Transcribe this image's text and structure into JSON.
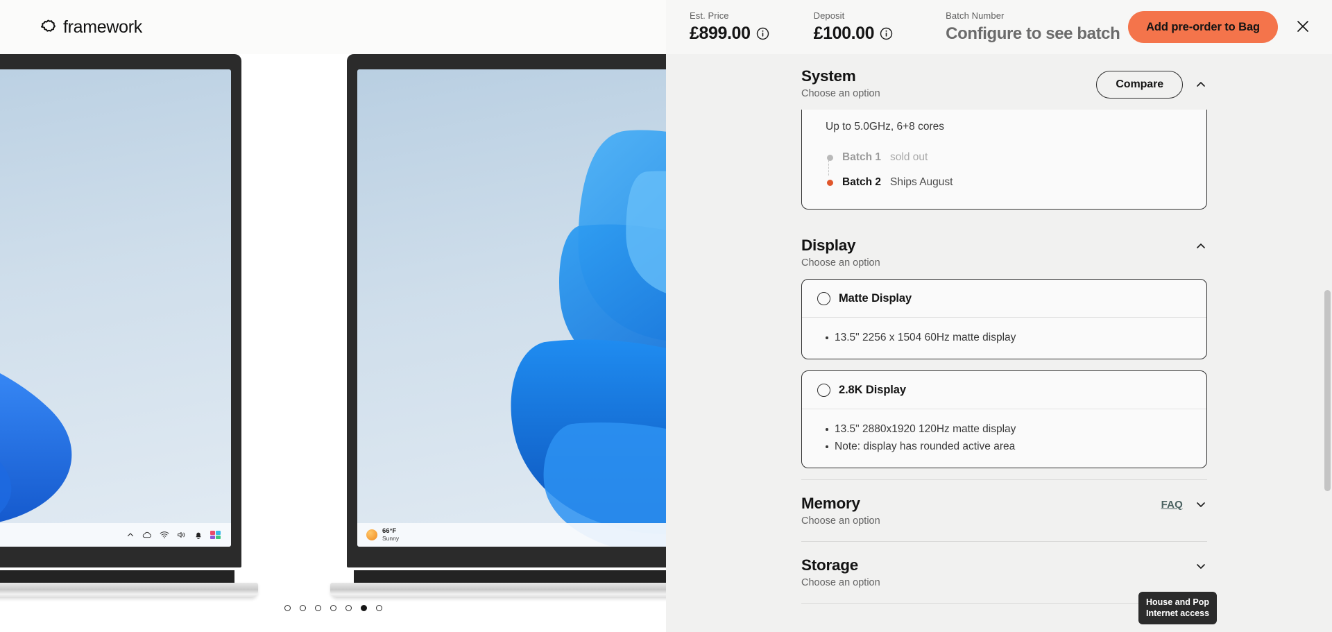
{
  "brand": {
    "name": "framework",
    "logo_icon": "framework-cog-logo"
  },
  "header": {
    "est_price": {
      "label": "Est. Price",
      "value": "£899.00",
      "info_icon": "info-circle-icon"
    },
    "deposit": {
      "label": "Deposit",
      "value": "£100.00",
      "info_icon": "info-circle-icon"
    },
    "batch_number": {
      "label": "Batch Number",
      "value": "Configure to see batch"
    },
    "cta_label": "Add pre-order to Bag",
    "close_icon": "close-x-icon",
    "accent_color": "#f4744b"
  },
  "gallery": {
    "laptops": [
      {
        "taskbar_type": "tray",
        "tray_icons": [
          "chevron-up-icon",
          "cloud-icon",
          "wifi-icon",
          "speaker-icon",
          "bell-icon",
          "widgets-icon"
        ]
      },
      {
        "taskbar_type": "weather",
        "weather_temp": "66°F",
        "weather_condition": "Sunny",
        "weather_icon": "sun-icon"
      }
    ],
    "dots_total": 7,
    "dots_active_index": 5
  },
  "config": {
    "sections": [
      {
        "id": "system",
        "title": "System",
        "subtitle": "Choose an option",
        "compare_label": "Compare",
        "collapse_icon": "chevron-up-icon",
        "expanded": true,
        "partial_card": {
          "spec_line": "Up to 5.0GHz, 6+8 cores",
          "batches": [
            {
              "name": "Batch 1",
              "status": "sold out",
              "state": "soldout"
            },
            {
              "name": "Batch 2",
              "status": "Ships August",
              "state": "active"
            }
          ]
        }
      },
      {
        "id": "display",
        "title": "Display",
        "subtitle": "Choose an option",
        "collapse_icon": "chevron-up-icon",
        "expanded": true,
        "options": [
          {
            "name": "Matte Display",
            "selected": false,
            "radio_icon": "radio-unchecked-icon",
            "bullets": [
              "13.5\" 2256 x 1504 60Hz matte display"
            ]
          },
          {
            "name": "2.8K Display",
            "selected": false,
            "radio_icon": "radio-unchecked-icon",
            "bullets": [
              "13.5\" 2880x1920 120Hz matte display",
              "Note: display has rounded active area"
            ]
          }
        ]
      },
      {
        "id": "memory",
        "title": "Memory",
        "subtitle": "Choose an option",
        "faq_label": "FAQ",
        "collapse_icon": "chevron-down-icon",
        "expanded": false
      },
      {
        "id": "storage",
        "title": "Storage",
        "subtitle": "Choose an option",
        "collapse_icon": "chevron-down-icon",
        "expanded": false
      }
    ]
  },
  "tooltip": {
    "line1": "House and Pop",
    "line2": "Internet access"
  },
  "scrollbar": {
    "present": true
  }
}
